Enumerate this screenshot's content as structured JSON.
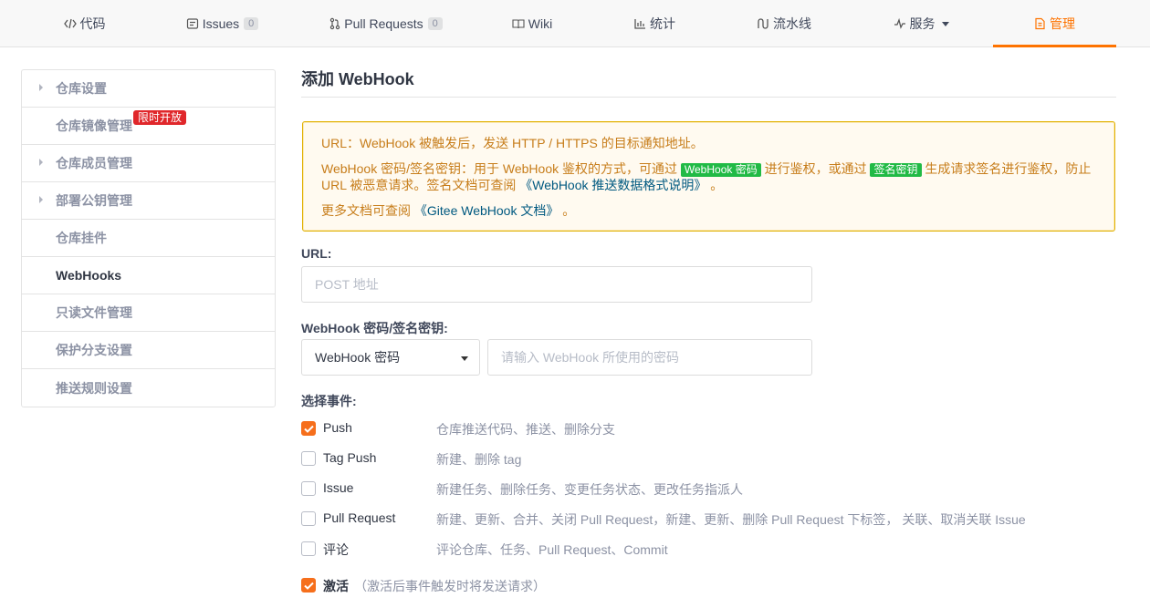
{
  "tabs": [
    {
      "label": "代码",
      "icon": "code-icon"
    },
    {
      "label": "Issues",
      "icon": "issues-icon",
      "count": "0"
    },
    {
      "label": "Pull Requests",
      "icon": "pull-request-icon",
      "count": "0"
    },
    {
      "label": "Wiki",
      "icon": "book-icon"
    },
    {
      "label": "统计",
      "icon": "bar-chart-icon"
    },
    {
      "label": "流水线",
      "icon": "pipeline-icon"
    },
    {
      "label": "服务",
      "icon": "pulse-icon"
    },
    {
      "label": "管理",
      "icon": "document-icon",
      "active": true
    }
  ],
  "sidebar": {
    "items": [
      {
        "label": "仓库设置",
        "expandable": true
      },
      {
        "label": "仓库镜像管理",
        "badge": "限时开放"
      },
      {
        "label": "仓库成员管理",
        "expandable": true
      },
      {
        "label": "部署公钥管理",
        "expandable": true
      },
      {
        "label": "仓库挂件"
      },
      {
        "label": "WebHooks",
        "active": true
      },
      {
        "label": "只读文件管理"
      },
      {
        "label": "保护分支设置"
      },
      {
        "label": "推送规则设置"
      }
    ]
  },
  "main": {
    "title": "添加 WebHook",
    "notice": {
      "line1": "URL：WebHook 被触发后，发送 HTTP / HTTPS 的目标通知地址。",
      "line2_a": "WebHook 密码/签名密钥：用于 WebHook 鉴权的方式，可通过",
      "tag1": "WebHook 密码",
      "line2_b": "进行鉴权，或通过",
      "tag2": "签名密钥",
      "line2_c": "生成请求签名进行鉴权，防止 URL 被恶意请求。签名文档可查阅",
      "link1": "《WebHook 推送数据格式说明》",
      "line2_end": "。",
      "line3_a": "更多文档可查阅",
      "link2": "《Gitee WebHook 文档》",
      "line3_end": "。"
    },
    "url_label": "URL:",
    "url_placeholder": "POST 地址",
    "secret_label": "WebHook 密码/签名密钥:",
    "secret_type": "WebHook 密码",
    "secret_placeholder": "请输入 WebHook 所使用的密码",
    "events_label": "选择事件:",
    "events": [
      {
        "name": "Push",
        "desc": "仓库推送代码、推送、删除分支",
        "checked": true
      },
      {
        "name": "Tag Push",
        "desc": "新建、删除 tag",
        "checked": false
      },
      {
        "name": "Issue",
        "desc": "新建任务、删除任务、变更任务状态、更改任务指派人",
        "checked": false
      },
      {
        "name": "Pull Request",
        "desc": "新建、更新、合并、关闭 Pull Request，新建、更新、删除 Pull Request 下标签， 关联、取消关联 Issue",
        "checked": false
      },
      {
        "name": "评论",
        "desc": "评论仓库、任务、Pull Request、Commit",
        "checked": false
      }
    ],
    "activate": {
      "label": "激活",
      "note": "（激活后事件触发时将发送请求）",
      "checked": true
    }
  },
  "colors": {
    "accent": "#fe7300",
    "checkbox": "#f66f1c",
    "tag": "#21ba45",
    "badge": "#e0272b",
    "notice_text": "#c77d1a"
  }
}
